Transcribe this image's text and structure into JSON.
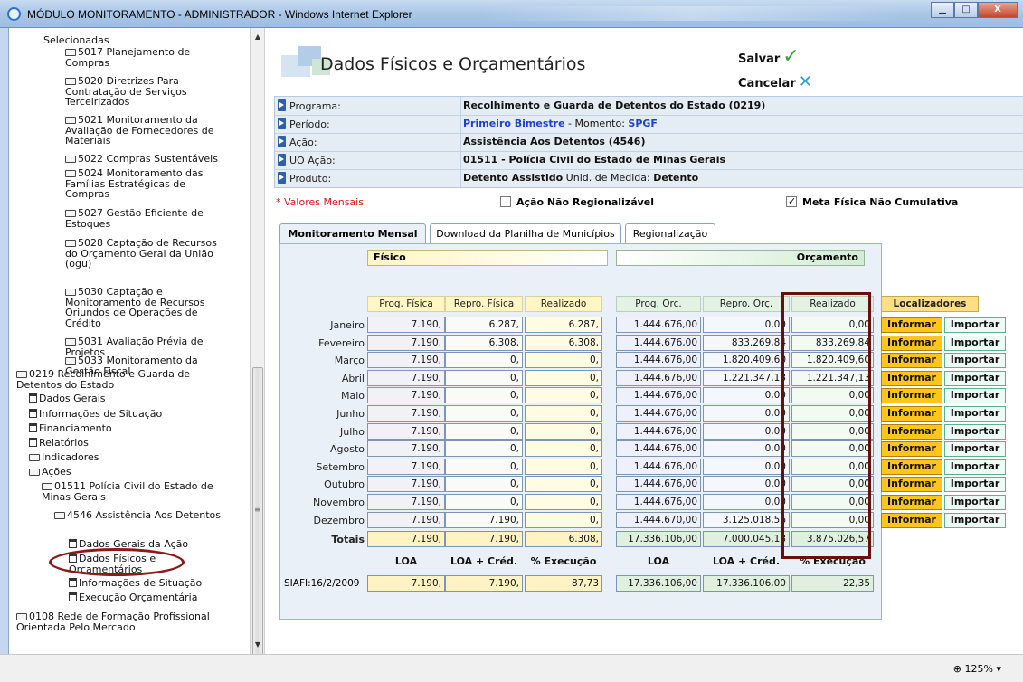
{
  "window": {
    "title": "MÓDULO MONITORAMENTO - ADMINISTRADOR - Windows Internet Explorer",
    "minimize": "▁",
    "maximize": "□",
    "close": "X"
  },
  "status": {
    "zoom": "125%"
  },
  "sidebar": {
    "nodes": [
      {
        "text": "Selecionadas",
        "icon": "none"
      },
      {
        "text": "5017 Planejamento de Compras",
        "icon": "folder"
      },
      {
        "text": "5020 Diretrizes Para Contratação de Serviços Terceirizados",
        "icon": "folder"
      },
      {
        "text": "5021 Monitoramento da Avaliação de Fornecedores de Materiais",
        "icon": "folder"
      },
      {
        "text": "5022 Compras Sustentáveis",
        "icon": "folder"
      },
      {
        "text": "5024 Monitoramento das Famílias Estratégicas de Compras",
        "icon": "folder"
      },
      {
        "text": "5027 Gestão Eficiente de Estoques",
        "icon": "folder"
      },
      {
        "text": "5028 Captação de Recursos do Orçamento Geral da União (ogu)",
        "icon": "folder"
      },
      {
        "text": "5030 Captação e Monitoramento de Recursos Oriundos de Operações de Crédito",
        "icon": "folder"
      },
      {
        "text": "5031 Avaliação Prévia de Projetos",
        "icon": "folder"
      },
      {
        "text": "5033 Monitoramento da Gestão Fiscal",
        "icon": "folder"
      },
      {
        "text": "0219 Recolhimento e Guarda de Detentos do Estado",
        "icon": "folder-open"
      },
      {
        "text": "Dados Gerais",
        "icon": "doc"
      },
      {
        "text": "Informações de Situação",
        "icon": "doc"
      },
      {
        "text": "Financiamento",
        "icon": "doc"
      },
      {
        "text": "Relatórios",
        "icon": "doc"
      },
      {
        "text": "Indicadores",
        "icon": "folder"
      },
      {
        "text": "Ações",
        "icon": "folder-open"
      },
      {
        "text": "01511 Polícia Civil do Estado de Minas Gerais",
        "icon": "folder-open"
      },
      {
        "text": "4546 Assistência Aos Detentos",
        "icon": "folder-open"
      },
      {
        "text": "Dados Gerais da Ação",
        "icon": "doc"
      },
      {
        "text": "Dados Físicos e Orçamentários",
        "icon": "doc"
      },
      {
        "text": "Informações de Situação",
        "icon": "doc"
      },
      {
        "text": "Execução Orçamentária",
        "icon": "doc"
      },
      {
        "text": "0108 Rede de Formação Profissional Orientada Pelo Mercado",
        "icon": "folder"
      }
    ]
  },
  "page": {
    "title": "Dados Físicos e Orçamentários",
    "save": "Salvar",
    "cancel": "Cancelar"
  },
  "info": [
    {
      "label": "Programa:",
      "value": "Recolhimento e Guarda de Detentos do Estado (0219)"
    },
    {
      "label": "Período:",
      "value": "Primeiro Bimestre",
      "extra": " - Momento: ",
      "extra2": "SPGF"
    },
    {
      "label": "Ação:",
      "value": "Assistência Aos Detentos (4546)"
    },
    {
      "label": "UO Ação:",
      "value": "01511 - Polícia Civil do Estado de Minas Gerais"
    },
    {
      "label": "Produto:",
      "value": "Detento Assistido",
      "extra": "  Unid. de Medida: ",
      "extra2": "Detento"
    }
  ],
  "flags": {
    "valores": "* Valores Mensais",
    "nao_regional": "Ação Não Regionalizável",
    "nao_regional_checked": false,
    "nao_cumulativa": "Meta Física Não Cumulativa",
    "nao_cumulativa_checked": true
  },
  "tabs": [
    "Monitoramento Mensal",
    "Download da Planilha de Municípios",
    "Regionalização"
  ],
  "table": {
    "banner_fisico": "Físico",
    "banner_orcamento": "Orçamento",
    "headers": [
      "Prog. Física",
      "Repro. Física",
      "Realizado",
      "Prog. Orç.",
      "Repro. Orç.",
      "Realizado"
    ],
    "loc_header": "Localizadores",
    "btn_informar": "Informar",
    "btn_importar": "Importar",
    "rows": [
      {
        "month": "Janeiro",
        "v": [
          "7.190,",
          "6.287,",
          "6.287,",
          "1.444.676,00",
          "0,00",
          "0,00"
        ]
      },
      {
        "month": "Fevereiro",
        "v": [
          "7.190,",
          "6.308,",
          "6.308,",
          "1.444.676,00",
          "833.269,84",
          "833.269,84"
        ]
      },
      {
        "month": "Março",
        "v": [
          "7.190,",
          "0,",
          "0,",
          "1.444.676,00",
          "1.820.409,60",
          "1.820.409,60"
        ]
      },
      {
        "month": "Abril",
        "v": [
          "7.190,",
          "0,",
          "0,",
          "1.444.676,00",
          "1.221.347,13",
          "1.221.347,13"
        ]
      },
      {
        "month": "Maio",
        "v": [
          "7.190,",
          "0,",
          "0,",
          "1.444.676,00",
          "0,00",
          "0,00"
        ]
      },
      {
        "month": "Junho",
        "v": [
          "7.190,",
          "0,",
          "0,",
          "1.444.676,00",
          "0,00",
          "0,00"
        ]
      },
      {
        "month": "Julho",
        "v": [
          "7.190,",
          "0,",
          "0,",
          "1.444.676,00",
          "0,00",
          "0,00"
        ]
      },
      {
        "month": "Agosto",
        "v": [
          "7.190,",
          "0,",
          "0,",
          "1.444.676,00",
          "0,00",
          "0,00"
        ]
      },
      {
        "month": "Setembro",
        "v": [
          "7.190,",
          "0,",
          "0,",
          "1.444.676,00",
          "0,00",
          "0,00"
        ]
      },
      {
        "month": "Outubro",
        "v": [
          "7.190,",
          "0,",
          "0,",
          "1.444.676,00",
          "0,00",
          "0,00"
        ]
      },
      {
        "month": "Novembro",
        "v": [
          "7.190,",
          "0,",
          "0,",
          "1.444.676,00",
          "0,00",
          "0,00"
        ]
      },
      {
        "month": "Dezembro",
        "v": [
          "7.190,",
          "7.190,",
          "0,",
          "1.444.670,00",
          "3.125.018,56",
          "0,00"
        ]
      }
    ],
    "totals": {
      "label": "Totais",
      "v": [
        "7.190,",
        "7.190,",
        "6.308,",
        "17.336.106,00",
        "7.000.045,13",
        "3.875.026,57"
      ]
    },
    "sub_headers": [
      "LOA",
      "LOA + Créd.",
      "% Execução",
      "LOA",
      "LOA + Créd.",
      "% Execução"
    ],
    "siafi": {
      "label": "SIAFI:16/2/2009",
      "v": [
        "7.190,",
        "7.190,",
        "87,73",
        "17.336.106,00",
        "17.336.106,00",
        "22,35"
      ]
    }
  }
}
